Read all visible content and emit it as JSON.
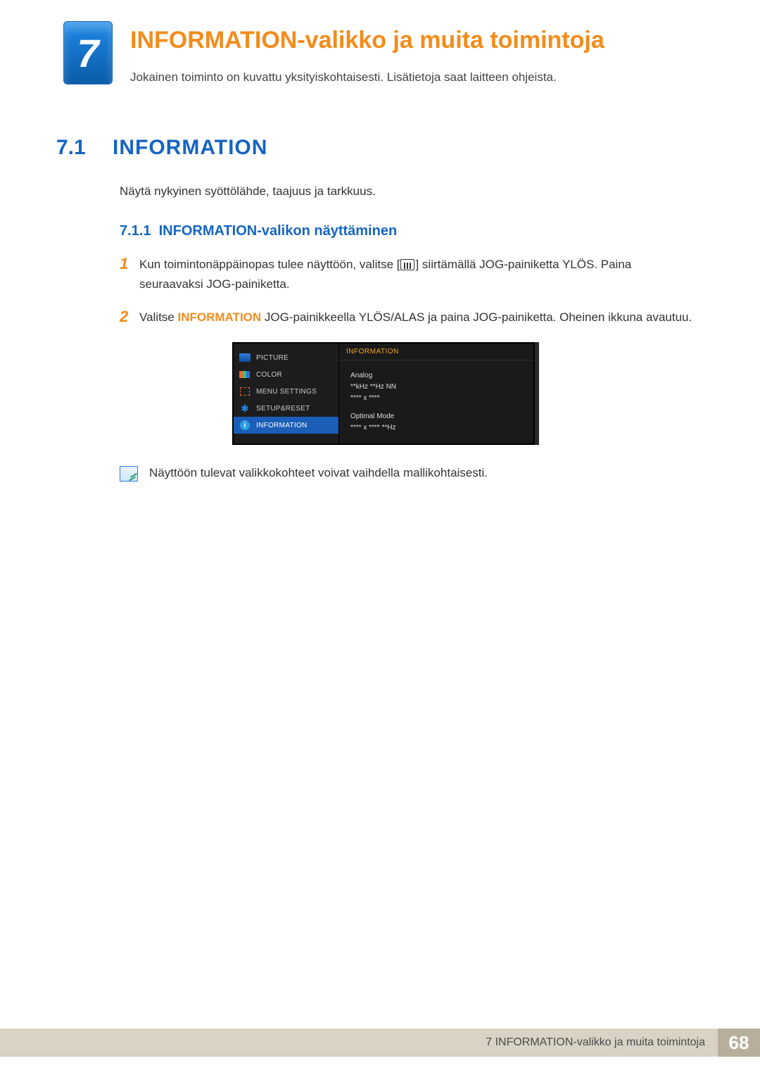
{
  "chapter": {
    "number": "7",
    "title": "INFORMATION-valikko ja muita toimintoja",
    "subtitle": "Jokainen toiminto on kuvattu yksityiskohtaisesti. Lisätietoja saat laitteen ohjeista."
  },
  "section": {
    "number": "7.1",
    "title": "INFORMATION",
    "intro": "Näytä nykyinen syöttölähde, taajuus ja tarkkuus."
  },
  "subsection": {
    "number": "7.1.1",
    "title": "INFORMATION-valikon näyttäminen"
  },
  "steps": [
    {
      "num": "1",
      "t1": "Kun toimintonäppäinopas tulee näyttöön, valitse [",
      "t2": "] siirtämällä JOG-painiketta YLÖS. Paina seuraavaksi JOG-painiketta."
    },
    {
      "num": "2",
      "t1": "Valitse ",
      "bold": "INFORMATION",
      "t2": " JOG-painikkeella YLÖS/ALAS ja paina JOG-painiketta. Oheinen ikkuna avautuu."
    }
  ],
  "osd": {
    "menu": [
      {
        "label": "PICTURE"
      },
      {
        "label": "COLOR"
      },
      {
        "label": "MENU SETTINGS"
      },
      {
        "label": "SETUP&RESET"
      },
      {
        "label": "INFORMATION"
      }
    ],
    "panel_title": "INFORMATION",
    "lines": {
      "l1": "Analog",
      "l2": "**kHz **Hz NN",
      "l3": "**** x ****",
      "l4": "Optimal Mode",
      "l5": "**** x **** **Hz"
    }
  },
  "note": "Näyttöön tulevat valikkokohteet voivat vaihdella mallikohtaisesti.",
  "footer": {
    "text": "7 INFORMATION-valikko ja muita toimintoja",
    "page": "68"
  }
}
